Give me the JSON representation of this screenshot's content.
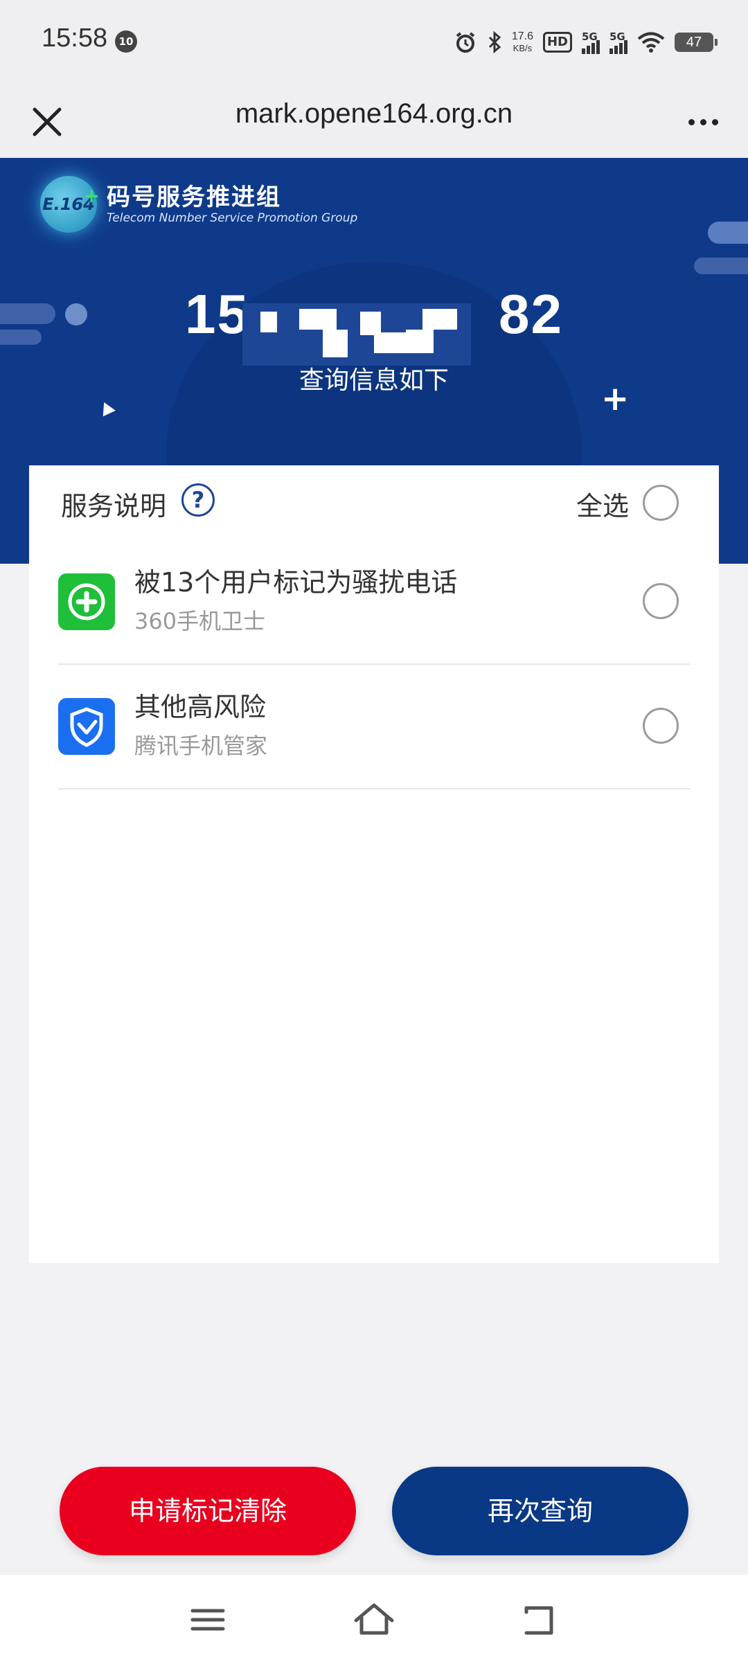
{
  "status_bar": {
    "time": "15:58",
    "notification_count": "10",
    "net_speed_value": "17.6",
    "net_speed_unit": "KB/s",
    "hd_label": "HD",
    "sim1_label": "5G",
    "sim2_label": "5G",
    "battery": "47"
  },
  "browser": {
    "url": "mark.opene164.org.cn"
  },
  "banner": {
    "logo_badge": "E.164",
    "logo_title": "码号服务推进组",
    "logo_subtitle": "Telecom Number Service Promotion Group",
    "phone_prefix": "15",
    "phone_suffix": "82",
    "query_subtitle": "查询信息如下"
  },
  "card": {
    "title": "服务说明",
    "help_symbol": "?",
    "select_all": "全选",
    "items": [
      {
        "title": "被13个用户标记为骚扰电话",
        "source": "360手机卫士",
        "icon": "360-security-icon"
      },
      {
        "title": "其他高风险",
        "source": "腾讯手机管家",
        "icon": "tencent-manager-icon"
      }
    ]
  },
  "actions": {
    "clear_mark": "申请标记清除",
    "query_again": "再次查询"
  },
  "colors": {
    "banner_blue": "#0f3a8a",
    "primary_red": "#e8001e",
    "primary_blue": "#093884",
    "green_360": "#1fbf3a",
    "tencent_blue": "#1a6ff0"
  }
}
